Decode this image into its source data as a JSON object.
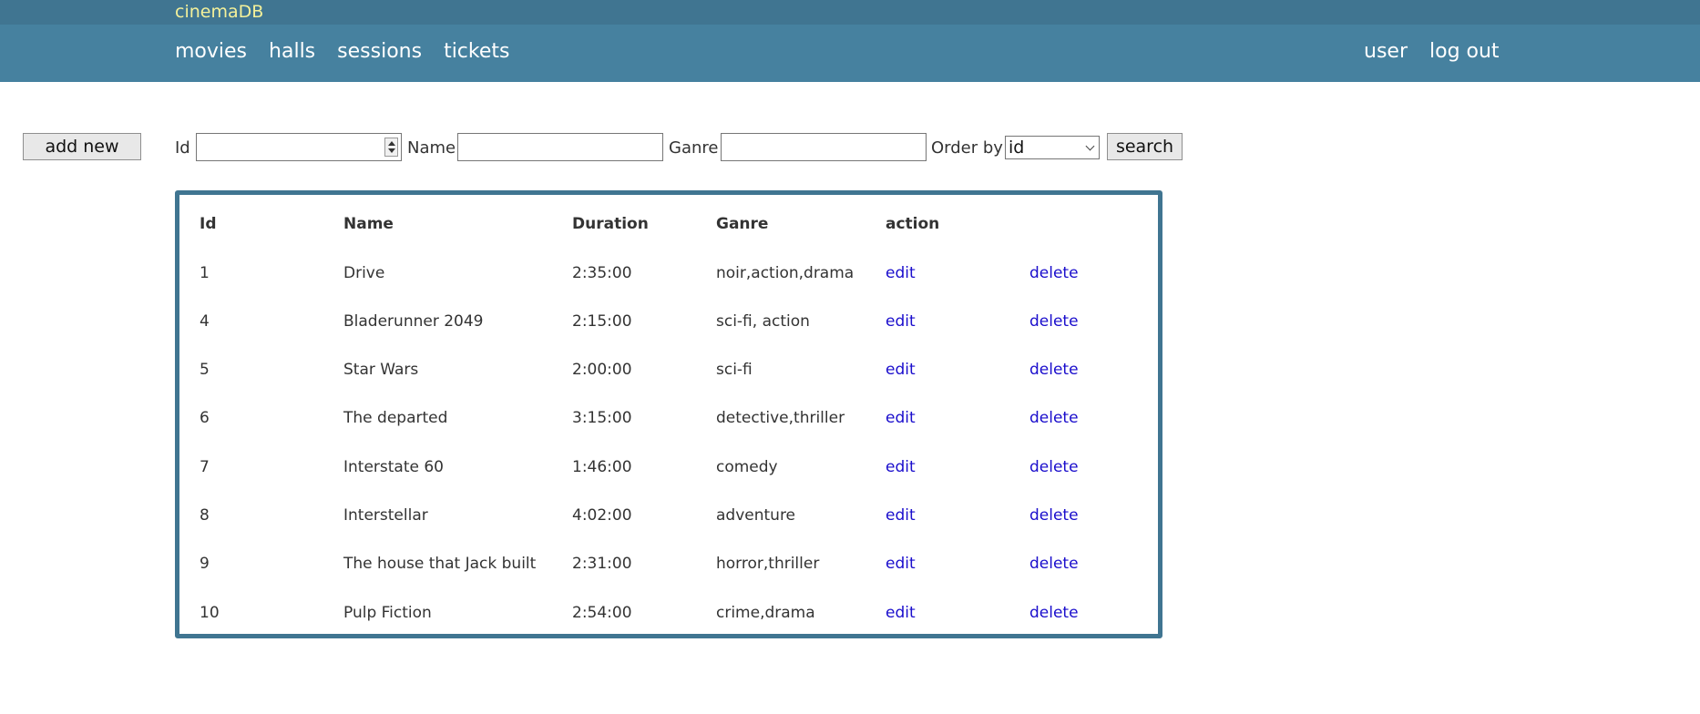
{
  "app": {
    "brand": "cinemaDB"
  },
  "nav": {
    "left": [
      "movies",
      "halls",
      "sessions",
      "tickets"
    ],
    "right": [
      "user",
      "log out"
    ]
  },
  "toolbar": {
    "add_label": "add new",
    "id_label": "Id",
    "id_value": "",
    "name_label": "Name",
    "name_value": "",
    "genre_label": "Ganre",
    "genre_value": "",
    "order_label": "Order by",
    "order_value": "id",
    "search_label": "search"
  },
  "table": {
    "headers": [
      "Id",
      "Name",
      "Duration",
      "Ganre",
      "action"
    ],
    "rows": [
      {
        "id": "1",
        "name": "Drive",
        "duration": "2:35:00",
        "genre": "noir,action,drama"
      },
      {
        "id": "4",
        "name": "Bladerunner 2049",
        "duration": "2:15:00",
        "genre": "sci-fi, action"
      },
      {
        "id": "5",
        "name": "Star Wars",
        "duration": "2:00:00",
        "genre": "sci-fi"
      },
      {
        "id": "6",
        "name": "The departed",
        "duration": "3:15:00",
        "genre": "detective,thriller"
      },
      {
        "id": "7",
        "name": "Interstate 60",
        "duration": "1:46:00",
        "genre": "comedy"
      },
      {
        "id": "8",
        "name": "Interstellar",
        "duration": "4:02:00",
        "genre": "adventure"
      },
      {
        "id": "9",
        "name": "The house that Jack built",
        "duration": "2:31:00",
        "genre": "horror,thriller"
      },
      {
        "id": "10",
        "name": "Pulp Fiction",
        "duration": "2:54:00",
        "genre": "crime,drama"
      }
    ],
    "edit_label": "edit",
    "delete_label": "delete"
  },
  "colors": {
    "topbar": "#407591",
    "navbar": "#46819f",
    "brand": "#f4f19a",
    "link": "#1a0dcc",
    "table_border": "#407591"
  }
}
